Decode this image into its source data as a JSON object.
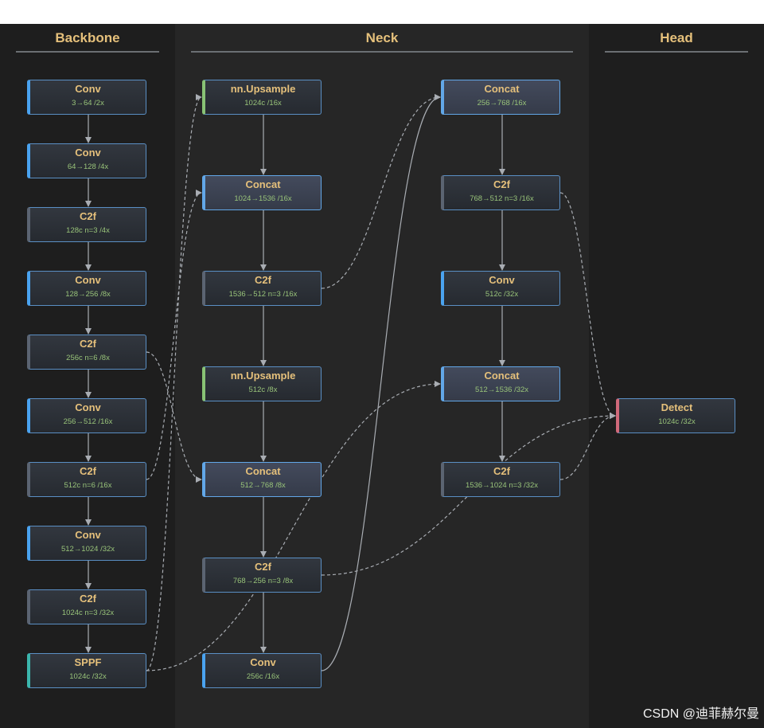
{
  "columns": {
    "backbone": "Backbone",
    "neck": "Neck",
    "head": "Head"
  },
  "nodes": [
    {
      "id": "b0",
      "title": "Conv",
      "sub": "3→64 /2x",
      "kind": "conv"
    },
    {
      "id": "b1",
      "title": "Conv",
      "sub": "64→128 /4x",
      "kind": "conv"
    },
    {
      "id": "b2",
      "title": "C2f",
      "sub": "128c n=3 /4x",
      "kind": "c2f"
    },
    {
      "id": "b3",
      "title": "Conv",
      "sub": "128→256 /8x",
      "kind": "conv"
    },
    {
      "id": "b4",
      "title": "C2f",
      "sub": "256c n=6 /8x",
      "kind": "c2f"
    },
    {
      "id": "b5",
      "title": "Conv",
      "sub": "256→512 /16x",
      "kind": "conv"
    },
    {
      "id": "b6",
      "title": "C2f",
      "sub": "512c n=6 /16x",
      "kind": "c2f"
    },
    {
      "id": "b7",
      "title": "Conv",
      "sub": "512→1024 /32x",
      "kind": "conv"
    },
    {
      "id": "b8",
      "title": "C2f",
      "sub": "1024c n=3 /32x",
      "kind": "c2f"
    },
    {
      "id": "b9",
      "title": "SPPF",
      "sub": "1024c /32x",
      "kind": "sppf"
    },
    {
      "id": "n0",
      "title": "nn.Upsample",
      "sub": "1024c /16x",
      "kind": "up"
    },
    {
      "id": "n1",
      "title": "Concat",
      "sub": "1024→1536 /16x",
      "kind": "concat"
    },
    {
      "id": "n2",
      "title": "C2f",
      "sub": "1536→512 n=3 /16x",
      "kind": "c2f"
    },
    {
      "id": "n3",
      "title": "nn.Upsample",
      "sub": "512c /8x",
      "kind": "up"
    },
    {
      "id": "n4",
      "title": "Concat",
      "sub": "512→768 /8x",
      "kind": "concat"
    },
    {
      "id": "n5",
      "title": "C2f",
      "sub": "768→256 n=3 /8x",
      "kind": "c2f"
    },
    {
      "id": "n6",
      "title": "Conv",
      "sub": "256c /16x",
      "kind": "conv"
    },
    {
      "id": "m0",
      "title": "Concat",
      "sub": "256→768 /16x",
      "kind": "concat"
    },
    {
      "id": "m1",
      "title": "C2f",
      "sub": "768→512 n=3 /16x",
      "kind": "c2f"
    },
    {
      "id": "m2",
      "title": "Conv",
      "sub": "512c /32x",
      "kind": "conv"
    },
    {
      "id": "m3",
      "title": "Concat",
      "sub": "512→1536 /32x",
      "kind": "concat"
    },
    {
      "id": "m4",
      "title": "C2f",
      "sub": "1536→1024 n=3 /32x",
      "kind": "c2f"
    },
    {
      "id": "h0",
      "title": "Detect",
      "sub": "1024c /32x",
      "kind": "detect"
    }
  ],
  "edges": [
    {
      "from": "b0",
      "to": "b1",
      "style": "solid"
    },
    {
      "from": "b1",
      "to": "b2",
      "style": "solid"
    },
    {
      "from": "b2",
      "to": "b3",
      "style": "solid"
    },
    {
      "from": "b3",
      "to": "b4",
      "style": "solid"
    },
    {
      "from": "b4",
      "to": "b5",
      "style": "solid"
    },
    {
      "from": "b5",
      "to": "b6",
      "style": "solid"
    },
    {
      "from": "b6",
      "to": "b7",
      "style": "solid"
    },
    {
      "from": "b7",
      "to": "b8",
      "style": "solid"
    },
    {
      "from": "b8",
      "to": "b9",
      "style": "solid"
    },
    {
      "from": "n0",
      "to": "n1",
      "style": "solid"
    },
    {
      "from": "n1",
      "to": "n2",
      "style": "solid"
    },
    {
      "from": "n2",
      "to": "n3",
      "style": "solid"
    },
    {
      "from": "n3",
      "to": "n4",
      "style": "solid"
    },
    {
      "from": "n4",
      "to": "n5",
      "style": "solid"
    },
    {
      "from": "n5",
      "to": "n6",
      "style": "solid"
    },
    {
      "from": "m0",
      "to": "m1",
      "style": "solid"
    },
    {
      "from": "m1",
      "to": "m2",
      "style": "solid"
    },
    {
      "from": "m2",
      "to": "m3",
      "style": "solid"
    },
    {
      "from": "m3",
      "to": "m4",
      "style": "solid"
    },
    {
      "from": "b9",
      "to": "n0",
      "style": "dashed"
    },
    {
      "from": "b6",
      "to": "n1",
      "style": "dashed"
    },
    {
      "from": "b4",
      "to": "n4",
      "style": "dashed"
    },
    {
      "from": "n2",
      "to": "m0",
      "style": "dashed"
    },
    {
      "from": "n6",
      "to": "m0",
      "style": "solid"
    },
    {
      "from": "b9",
      "to": "m3",
      "style": "dashed"
    },
    {
      "from": "m1",
      "to": "h0",
      "style": "dashed"
    },
    {
      "from": "n5",
      "to": "h0",
      "style": "dashed"
    },
    {
      "from": "m4",
      "to": "h0",
      "style": "dashed"
    }
  ],
  "colors": {
    "title": "#e5c07b",
    "subtitle": "#98c379",
    "edge": "#a9adb3"
  },
  "watermark": "CSDN @迪菲赫尔曼"
}
